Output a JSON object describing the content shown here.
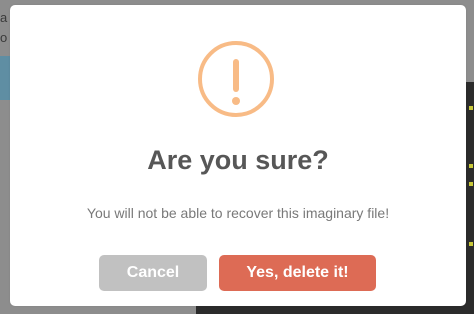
{
  "background": {
    "text_lines": "a\no"
  },
  "dialog": {
    "icon": "warning-exclamation-icon",
    "icon_color": "#f8bb86",
    "title": "Are you sure?",
    "message": "You will not be able to recover this imaginary file!",
    "cancel_label": "Cancel",
    "cancel_color": "#c1c1c1",
    "confirm_label": "Yes, delete it!",
    "confirm_color": "#dd6b55"
  }
}
